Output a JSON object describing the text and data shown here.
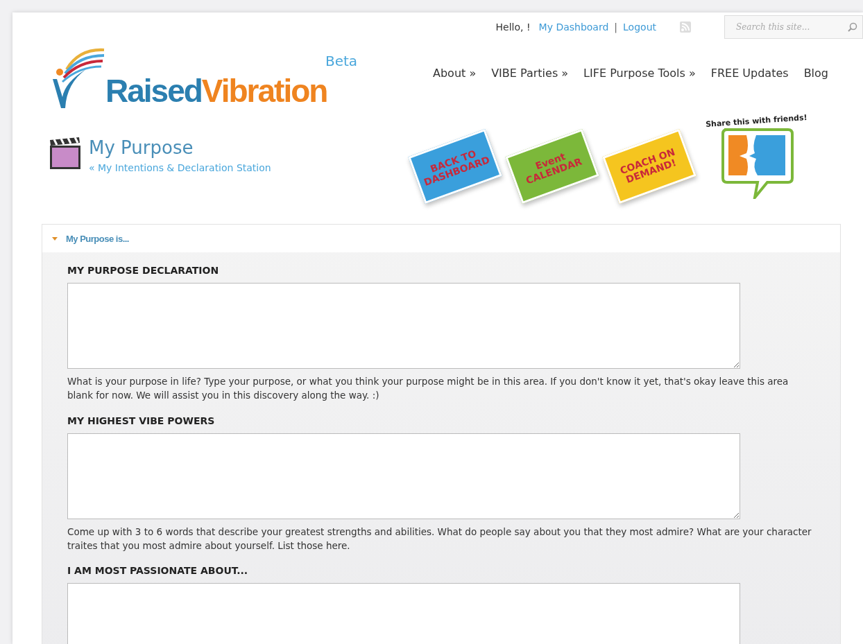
{
  "header": {
    "greeting": "Hello, !",
    "links": [
      {
        "label": "My Dashboard"
      },
      {
        "label": "Logout"
      }
    ],
    "separator": "|",
    "search": {
      "placeholder": "Search this site..."
    }
  },
  "logo": {
    "part_1": "Raised",
    "part_2": "Vibration",
    "badge": "Beta"
  },
  "nav": [
    "About »",
    "VIBE Parties »",
    "LIFE Purpose Tools »",
    "FREE Updates",
    "Blog"
  ],
  "page": {
    "title": "My Purpose",
    "breadcrumb": "« My Intentions & Declaration Station"
  },
  "stickers": [
    {
      "line_1": "BACK TO",
      "line_2": "DASHBOARD",
      "color": "#3a9fdc"
    },
    {
      "line_1": "Event",
      "line_2": "CALENDAR",
      "color": "#7cb83a"
    },
    {
      "line_1": "COACH ON",
      "line_2": "DEMAND!",
      "color": "#f5c51f"
    }
  ],
  "share": {
    "caption": "Share this with friends!"
  },
  "panel": {
    "title": "My Purpose is...",
    "expanded": true,
    "fields": [
      {
        "label": "MY PURPOSE DECLARATION",
        "help": "What is your purpose in life? Type your purpose, or what you think your purpose might be in this area. If you don't know it yet, that's okay leave this area blank for now. We will assist you in this discovery along the way. :)"
      },
      {
        "label": "MY HIGHEST VIBE POWERS",
        "help": "Come up with 3 to 6 words that describe your greatest strengths and abilities. What do people say about you that they most admire? What are your character traites that you most admire about yourself. List those here."
      },
      {
        "label": "I AM MOST PASSIONATE ABOUT..."
      }
    ]
  }
}
